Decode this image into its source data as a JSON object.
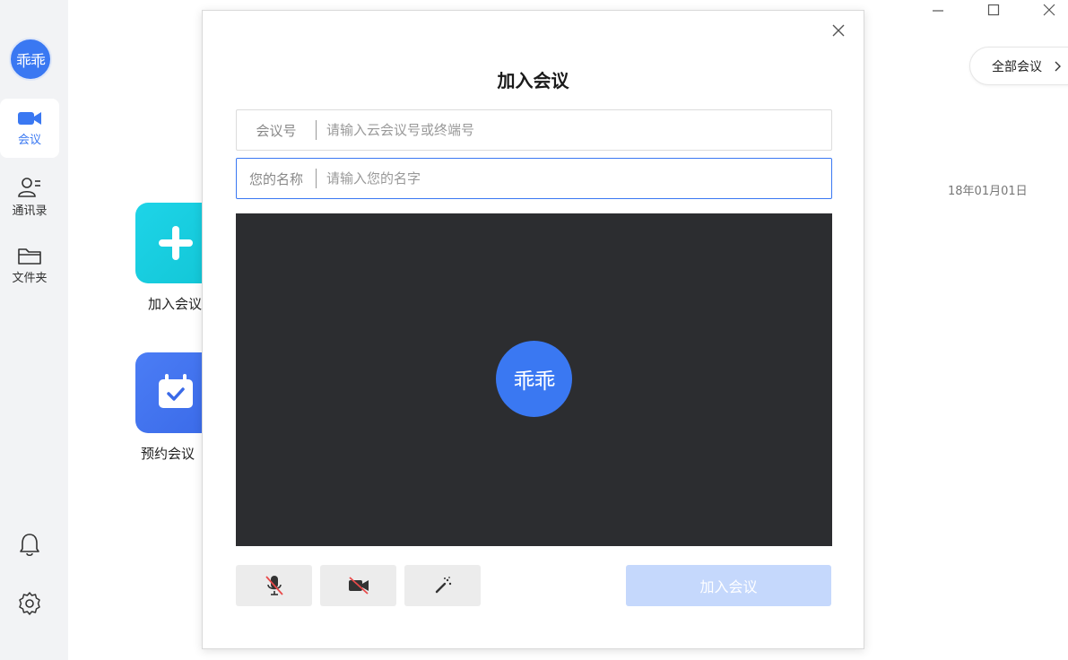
{
  "sidebar": {
    "avatar_text": "乖乖",
    "items": [
      {
        "label": "会议",
        "icon": "video-camera-icon"
      },
      {
        "label": "通讯录",
        "icon": "contacts-icon"
      },
      {
        "label": "文件夹",
        "icon": "folder-icon"
      }
    ],
    "bottom_icons": [
      "bell-icon",
      "gear-icon"
    ]
  },
  "main": {
    "tiles": [
      {
        "label": "加入会议",
        "icon": "plus-icon"
      },
      {
        "label": "预约会议",
        "icon": "calendar-check-icon"
      }
    ],
    "all_meetings_label": "全部会议",
    "date": "18年01月01日"
  },
  "window_controls": [
    "minimize-icon",
    "maximize-icon",
    "close-icon"
  ],
  "dialog": {
    "title": "加入会议",
    "meeting_id": {
      "label": "会议号",
      "placeholder": "请输入云会议号或终端号",
      "value": ""
    },
    "name": {
      "label": "您的名称",
      "placeholder": "请输入您的名字",
      "value": ""
    },
    "preview_avatar_text": "乖乖",
    "controls": [
      "mic-muted-icon",
      "camera-off-icon",
      "beauty-wand-icon"
    ],
    "join_button_label": "加入会议"
  },
  "colors": {
    "accent": "#3a78f2",
    "preview_bg": "#2c2d30",
    "join_disabled": "#c5d8fc"
  }
}
